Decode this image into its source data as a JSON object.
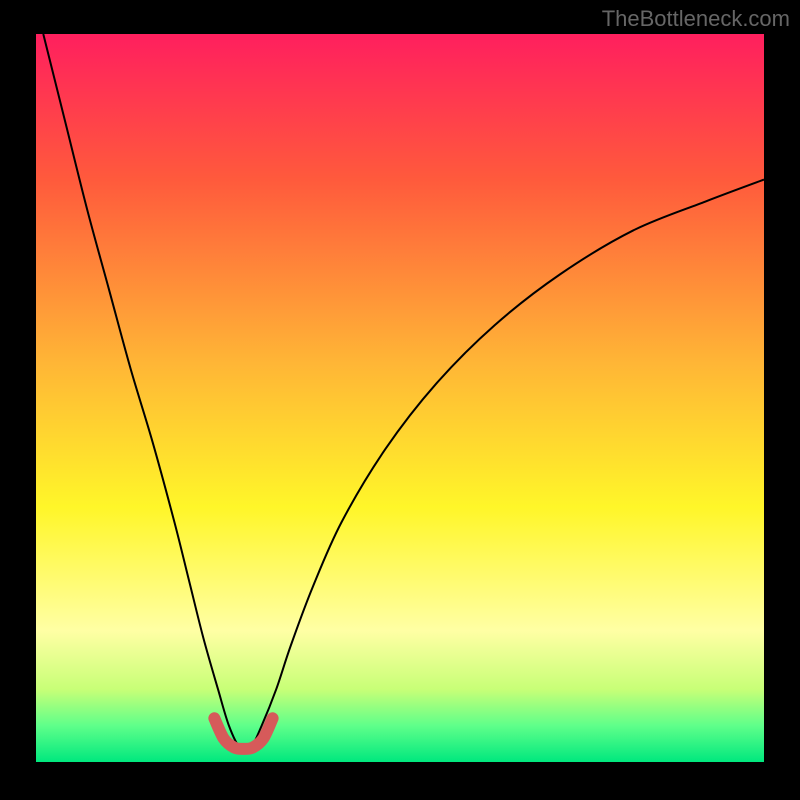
{
  "watermark": "TheBottleneck.com",
  "chart_data": {
    "type": "line",
    "title": "",
    "xlabel": "",
    "ylabel": "",
    "xlim": [
      0,
      100
    ],
    "ylim": [
      0,
      100
    ],
    "grid": false,
    "legend": false,
    "background_gradient": {
      "stops": [
        {
          "offset": 0.0,
          "color": "#ff1f5e"
        },
        {
          "offset": 0.2,
          "color": "#ff5a3c"
        },
        {
          "offset": 0.45,
          "color": "#ffb536"
        },
        {
          "offset": 0.65,
          "color": "#fff629"
        },
        {
          "offset": 0.82,
          "color": "#ffffa4"
        },
        {
          "offset": 0.9,
          "color": "#c8ff77"
        },
        {
          "offset": 0.95,
          "color": "#5fff8a"
        },
        {
          "offset": 1.0,
          "color": "#00e87e"
        }
      ]
    },
    "series": [
      {
        "name": "bottleneck-curve",
        "stroke": "#000000",
        "stroke_width": 2,
        "x": [
          1,
          4,
          7,
          10,
          13,
          16,
          19,
          21,
          23,
          25,
          26.5,
          28,
          29.5,
          31,
          33,
          35,
          38,
          42,
          48,
          55,
          63,
          72,
          82,
          92,
          100
        ],
        "y": [
          100,
          88,
          76,
          65,
          54,
          44,
          33,
          25,
          17,
          10,
          5,
          2,
          2,
          5,
          10,
          16,
          24,
          33,
          43,
          52,
          60,
          67,
          73,
          77,
          80
        ]
      },
      {
        "name": "optimal-band",
        "stroke": "#d65a5a",
        "stroke_width": 12,
        "linecap": "round",
        "x": [
          24.5,
          25.8,
          27.2,
          28.5,
          29.8,
          31.2,
          32.5
        ],
        "y": [
          6,
          3.2,
          2.0,
          1.8,
          2.0,
          3.2,
          6
        ]
      }
    ]
  }
}
